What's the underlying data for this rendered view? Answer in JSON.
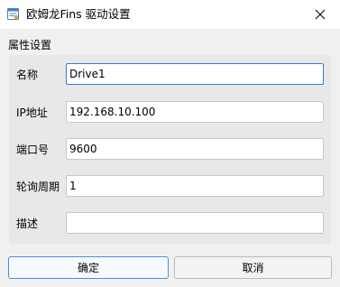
{
  "window": {
    "title": "欧姆龙Fins 驱动设置",
    "icon": "settings-window-icon",
    "close_icon": "close-icon"
  },
  "group": {
    "title": "属性设置"
  },
  "fields": [
    {
      "label": "名称",
      "value": "Drive1"
    },
    {
      "label": "IP地址",
      "value": "192.168.10.100"
    },
    {
      "label": "端口号",
      "value": "9600"
    },
    {
      "label": "轮询周期",
      "value": "1"
    },
    {
      "label": "描述",
      "value": ""
    }
  ],
  "buttons": {
    "ok_label": "确定",
    "cancel_label": "取消"
  },
  "colors": {
    "focus_border": "#2f7fd6",
    "group_background": "#e8e8e8",
    "window_background": "#f0f0f0"
  }
}
